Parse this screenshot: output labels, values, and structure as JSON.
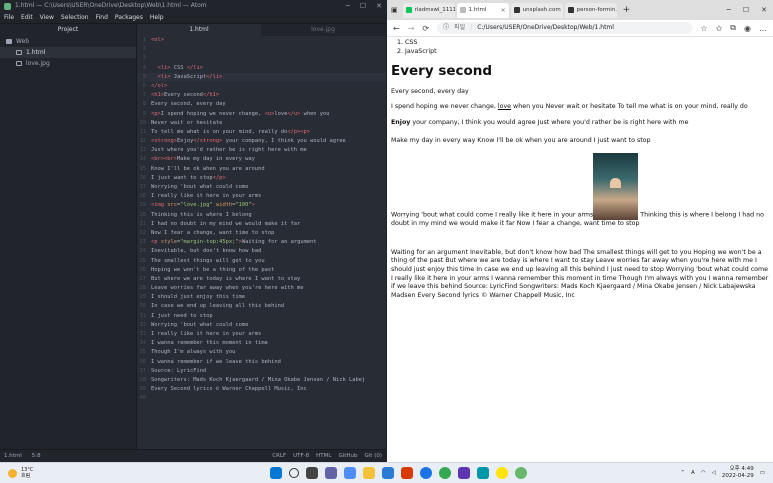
{
  "atom": {
    "window_title": "1.html — C:\\Users\\USER\\OneDrive\\Desktop\\Web\\1.html — Atom",
    "menu": [
      "File",
      "Edit",
      "View",
      "Selection",
      "Find",
      "Packages",
      "Help"
    ],
    "tree_header": "Project",
    "tree": [
      {
        "label": "Web",
        "type": "folder"
      },
      {
        "label": "1.html",
        "type": "file",
        "selected": true
      },
      {
        "label": "love.jpg",
        "type": "file"
      }
    ],
    "tabs": [
      "1.html",
      "love.jpg"
    ],
    "code_lines": [
      {
        "n": "1",
        "html": "<span class='tg'>&lt;ol&gt;</span>"
      },
      {
        "n": "2",
        "html": ""
      },
      {
        "n": "3",
        "html": ""
      },
      {
        "n": "4",
        "html": "  <span class='tg'>&lt;li&gt;</span> CSS <span class='tg'>&lt;/li&gt;</span>"
      },
      {
        "n": "5",
        "html": "  <span class='tg'>&lt;li&gt;</span> JavaScript<span class='tg'>&lt;/li&gt;</span>",
        "cur": true
      },
      {
        "n": "6",
        "html": "<span class='tg'>&lt;/ol&gt;</span>"
      },
      {
        "n": "7",
        "html": "<span class='tg'>&lt;h1&gt;</span>Every second<span class='tg'>&lt;/h1&gt;</span>"
      },
      {
        "n": "8",
        "html": "Every second, every day"
      },
      {
        "n": "9",
        "html": "<span class='tg'>&lt;p&gt;</span>I spend hoping we never change, <span class='tg'>&lt;u&gt;</span>love<span class='tg'>&lt;/u&gt;</span> when you"
      },
      {
        "n": "10",
        "html": "Never wait or hesitate"
      },
      {
        "n": "11",
        "html": "To tell me what is on your mind, really do<span class='tg'>&lt;/p&gt;&lt;p&gt;</span>"
      },
      {
        "n": "12",
        "html": "<span class='tg'>&lt;strong&gt;</span>Enjoy<span class='tg'>&lt;/strong&gt;</span> your company, I think you would agree"
      },
      {
        "n": "13",
        "html": "Just where you'd rather be is right here with me"
      },
      {
        "n": "14",
        "html": "<span class='tg'>&lt;br&gt;&lt;br&gt;</span>Make my day in every way"
      },
      {
        "n": "15",
        "html": "Know I'll be ok when you are around"
      },
      {
        "n": "16",
        "html": "I just want to stop<span class='tg'>&lt;/p&gt;</span>"
      },
      {
        "n": "17",
        "html": "Worrying 'bout what could come"
      },
      {
        "n": "18",
        "html": "I really like it here in your arms"
      },
      {
        "n": "19",
        "html": "<span class='tg'>&lt;img</span> <span class='at'>src</span>=<span class='st'>\"love.jpg\"</span> <span class='at'>width</span>=<span class='st'>\"100\"</span><span class='tg'>&gt;</span>"
      },
      {
        "n": "20",
        "html": "Thinking this is where I belong"
      },
      {
        "n": "21",
        "html": "I had no doubt in my mind we would make it far"
      },
      {
        "n": "22",
        "html": "Now I fear a change, want time to stop"
      },
      {
        "n": "23",
        "html": "<span class='tg'>&lt;p</span> <span class='at'>style</span>=<span class='st'>\"margin-top:45px;\"</span><span class='tg'>&gt;</span>Waiting for an argument"
      },
      {
        "n": "24",
        "html": "Inevitable, but don't know how bad"
      },
      {
        "n": "25",
        "html": "The smallest things will get to you"
      },
      {
        "n": "26",
        "html": "Hoping we won't be a thing of the past"
      },
      {
        "n": "27",
        "html": "But where we are today is where I want to stay"
      },
      {
        "n": "28",
        "html": "Leave worries far away when you're here with me"
      },
      {
        "n": "29",
        "html": "I should just enjoy this time"
      },
      {
        "n": "30",
        "html": "In case we end up leaving all this behind"
      },
      {
        "n": "31",
        "html": "I just need to stop"
      },
      {
        "n": "32",
        "html": "Worrying 'bout what could come"
      },
      {
        "n": "33",
        "html": "I really like it here in your arms"
      },
      {
        "n": "34",
        "html": "I wanna remember this moment in time"
      },
      {
        "n": "35",
        "html": "Though I'm always with you"
      },
      {
        "n": "36",
        "html": "I wanna remember if we leave this behind"
      },
      {
        "n": "37",
        "html": "Source: LyricFind"
      },
      {
        "n": "38",
        "html": "Songwriters: Mads Koch Kjaergaard / Mina Okabe Jensen / Nick Labej"
      },
      {
        "n": "39",
        "html": "Every Second lyrics © Warner Chappell Music, Inc"
      },
      {
        "n": "40",
        "html": ""
      }
    ],
    "status": {
      "file": "1.html",
      "pos": "5:8",
      "eol": "CRLF",
      "enc": "UTF-8",
      "grammar": "HTML",
      "github": "GitHub",
      "git": "Git (0)"
    }
  },
  "browser": {
    "tabs": [
      {
        "label": "rladmswl_1111",
        "color": "#03c75a",
        "active": false
      },
      {
        "label": "1.html",
        "color": "#bbbbbb",
        "active": true
      },
      {
        "label": "unsplash.com",
        "color": "#333333",
        "active": false
      },
      {
        "label": "person-formin...",
        "color": "#333333",
        "active": false
      }
    ],
    "address_label": "파일",
    "address": "C:/Users/USER/OneDrive/Desktop/Web/1.html",
    "page": {
      "list": [
        "CSS",
        "JavaScript"
      ],
      "heading": "Every second",
      "line1": "Every second, every day",
      "p1_before": "I spend hoping we never change, ",
      "p1_underline": "love",
      "p1_after": " when you Never wait or hesitate To tell me what is on your mind, really do",
      "p2_bold": "Enjoy",
      "p2_rest": " your company, I think you would agree Just where you'd rather be is right here with me",
      "p3": "Make my day in every way Know I'll be ok when you are around I just want to stop",
      "p4_before": "Worrying 'bout what could come I really like it here in your arms",
      "p4_after": " Thinking this is where I belong I had no doubt in my mind we would make it far Now I fear a change, want time to stop",
      "p5": "Waiting for an argument Inevitable, but don't know how bad The smallest things will get to you Hoping we won't be a thing of the past But where we are today is where I want to stay Leave worries far away when you're here with me I should just enjoy this time In case we end up leaving all this behind I just need to stop Worrying 'bout what could come I really like it here in your arms I wanna remember this moment in time Though I'm always with you I wanna remember if we leave this behind Source: LyricFind Songwriters: Mads Koch Kjaergaard / Mina Okabe Jensen / Nick Labajewska Madsen Every Second lyrics © Warner Chappell Music, Inc"
    }
  },
  "taskbar": {
    "temp": "13°C",
    "weather": "흐림",
    "time": "오후 4:49",
    "date": "2022-04-29",
    "ime": "A"
  }
}
